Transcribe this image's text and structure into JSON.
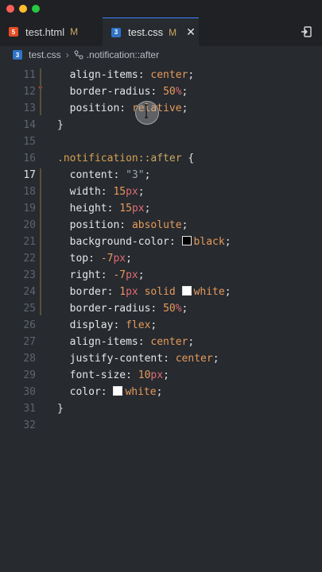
{
  "tabs": [
    {
      "label": "test.html",
      "status": "M",
      "icon": "html5-file-icon"
    },
    {
      "label": "test.css",
      "status": "M",
      "icon": "css3-file-icon"
    }
  ],
  "breadcrumb": {
    "file": "test.css",
    "symbol": ".notification::after"
  },
  "editor": {
    "current_line": 17,
    "lines": [
      {
        "n": "11",
        "t": [
          [
            "prop",
            "  align-items"
          ],
          [
            "punct",
            ": "
          ],
          [
            "val",
            "center"
          ],
          [
            "punct",
            ";"
          ]
        ]
      },
      {
        "n": "12",
        "t": [
          [
            "prop",
            "  border-radius"
          ],
          [
            "punct",
            ": "
          ],
          [
            "num",
            "50"
          ],
          [
            "unit",
            "%"
          ],
          [
            "punct",
            ";"
          ]
        ]
      },
      {
        "n": "13",
        "t": [
          [
            "prop",
            "  position"
          ],
          [
            "punct",
            ": "
          ],
          [
            "val",
            "relative"
          ],
          [
            "punct",
            ";"
          ]
        ]
      },
      {
        "n": "14",
        "t": [
          [
            "punct",
            "}"
          ]
        ]
      },
      {
        "n": "15",
        "t": []
      },
      {
        "n": "16",
        "t": [
          [
            "selector",
            ".notification"
          ],
          [
            "pseudo",
            "::after"
          ],
          [
            "punct",
            " {"
          ]
        ]
      },
      {
        "n": "17",
        "t": [
          [
            "prop",
            "  content"
          ],
          [
            "punct",
            ": "
          ],
          [
            "str",
            "\"3\""
          ],
          [
            "punct",
            ";"
          ]
        ]
      },
      {
        "n": "18",
        "t": [
          [
            "prop",
            "  width"
          ],
          [
            "punct",
            ": "
          ],
          [
            "num",
            "15"
          ],
          [
            "unit",
            "px"
          ],
          [
            "punct",
            ";"
          ]
        ]
      },
      {
        "n": "19",
        "t": [
          [
            "prop",
            "  height"
          ],
          [
            "punct",
            ": "
          ],
          [
            "num",
            "15"
          ],
          [
            "unit",
            "px"
          ],
          [
            "punct",
            ";"
          ]
        ]
      },
      {
        "n": "20",
        "t": [
          [
            "prop",
            "  position"
          ],
          [
            "punct",
            ": "
          ],
          [
            "val",
            "absolute"
          ],
          [
            "punct",
            ";"
          ]
        ]
      },
      {
        "n": "21",
        "t": [
          [
            "prop",
            "  background-color"
          ],
          [
            "punct",
            ": "
          ],
          [
            "swatch",
            "black"
          ],
          [
            "val",
            "black"
          ],
          [
            "punct",
            ";"
          ]
        ]
      },
      {
        "n": "22",
        "t": [
          [
            "prop",
            "  top"
          ],
          [
            "punct",
            ": "
          ],
          [
            "num",
            "-7"
          ],
          [
            "unit",
            "px"
          ],
          [
            "punct",
            ";"
          ]
        ]
      },
      {
        "n": "23",
        "t": [
          [
            "prop",
            "  right"
          ],
          [
            "punct",
            ": "
          ],
          [
            "num",
            "-7"
          ],
          [
            "unit",
            "px"
          ],
          [
            "punct",
            ";"
          ]
        ]
      },
      {
        "n": "24",
        "t": [
          [
            "prop",
            "  border"
          ],
          [
            "punct",
            ": "
          ],
          [
            "num",
            "1"
          ],
          [
            "unit",
            "px"
          ],
          [
            "val",
            " solid "
          ],
          [
            "swatch",
            "white"
          ],
          [
            "val",
            "white"
          ],
          [
            "punct",
            ";"
          ]
        ]
      },
      {
        "n": "25",
        "t": [
          [
            "prop",
            "  border-radius"
          ],
          [
            "punct",
            ": "
          ],
          [
            "num",
            "50"
          ],
          [
            "unit",
            "%"
          ],
          [
            "punct",
            ";"
          ]
        ]
      },
      {
        "n": "26",
        "t": [
          [
            "prop",
            "  display"
          ],
          [
            "punct",
            ": "
          ],
          [
            "val",
            "flex"
          ],
          [
            "punct",
            ";"
          ]
        ]
      },
      {
        "n": "27",
        "t": [
          [
            "prop",
            "  align-items"
          ],
          [
            "punct",
            ": "
          ],
          [
            "val",
            "center"
          ],
          [
            "punct",
            ";"
          ]
        ]
      },
      {
        "n": "28",
        "t": [
          [
            "prop",
            "  justify-content"
          ],
          [
            "punct",
            ": "
          ],
          [
            "val",
            "center"
          ],
          [
            "punct",
            ";"
          ]
        ]
      },
      {
        "n": "29",
        "t": [
          [
            "prop",
            "  font-size"
          ],
          [
            "punct",
            ": "
          ],
          [
            "num",
            "10"
          ],
          [
            "unit",
            "px"
          ],
          [
            "punct",
            ";"
          ]
        ]
      },
      {
        "n": "30",
        "t": [
          [
            "prop",
            "  color"
          ],
          [
            "punct",
            ": "
          ],
          [
            "swatch",
            "white"
          ],
          [
            "val",
            "white"
          ],
          [
            "punct",
            ";"
          ]
        ]
      },
      {
        "n": "31",
        "t": [
          [
            "punct",
            "}"
          ]
        ]
      },
      {
        "n": "32",
        "t": []
      }
    ]
  }
}
